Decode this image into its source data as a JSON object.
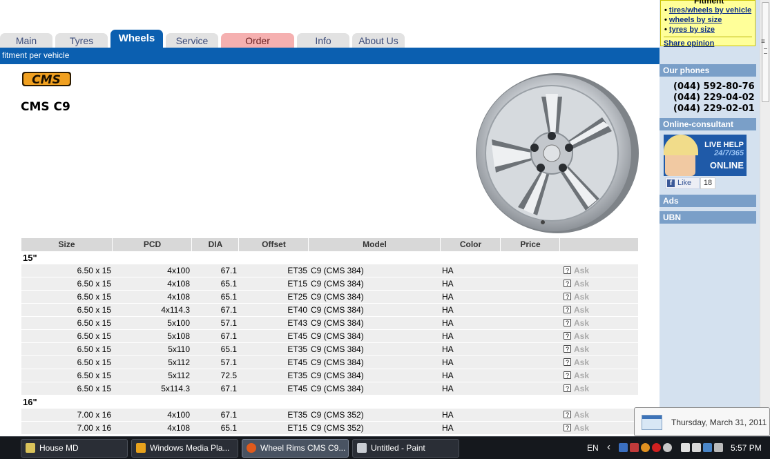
{
  "tabs": [
    "Main",
    "Tyres",
    "Wheels",
    "Service",
    "Order",
    "Info",
    "About Us"
  ],
  "subnav": "fitment per vehicle",
  "brand_logo_text": "CMS",
  "product_title": "CMS C9",
  "table": {
    "headers": [
      "Size",
      "PCD",
      "DIA",
      "Offset",
      "Model",
      "Color",
      "Price",
      ""
    ],
    "groups": [
      {
        "label": "15\"",
        "rows": [
          {
            "size": "6.50 x 15",
            "pcd": "4x100",
            "dia": "67.1",
            "offset": "ET35",
            "model": "C9 (CMS 384)",
            "color": "HA",
            "price": "",
            "ask": "Ask"
          },
          {
            "size": "6.50 x 15",
            "pcd": "4x108",
            "dia": "65.1",
            "offset": "ET15",
            "model": "C9 (CMS 384)",
            "color": "HA",
            "price": "",
            "ask": "Ask"
          },
          {
            "size": "6.50 x 15",
            "pcd": "4x108",
            "dia": "65.1",
            "offset": "ET25",
            "model": "C9 (CMS 384)",
            "color": "HA",
            "price": "",
            "ask": "Ask"
          },
          {
            "size": "6.50 x 15",
            "pcd": "4x114.3",
            "dia": "67.1",
            "offset": "ET40",
            "model": "C9 (CMS 384)",
            "color": "HA",
            "price": "",
            "ask": "Ask"
          },
          {
            "size": "6.50 x 15",
            "pcd": "5x100",
            "dia": "57.1",
            "offset": "ET43",
            "model": "C9 (CMS 384)",
            "color": "HA",
            "price": "",
            "ask": "Ask"
          },
          {
            "size": "6.50 x 15",
            "pcd": "5x108",
            "dia": "67.1",
            "offset": "ET45",
            "model": "C9 (CMS 384)",
            "color": "HA",
            "price": "",
            "ask": "Ask"
          },
          {
            "size": "6.50 x 15",
            "pcd": "5x110",
            "dia": "65.1",
            "offset": "ET35",
            "model": "C9 (CMS 384)",
            "color": "HA",
            "price": "",
            "ask": "Ask"
          },
          {
            "size": "6.50 x 15",
            "pcd": "5x112",
            "dia": "57.1",
            "offset": "ET45",
            "model": "C9 (CMS 384)",
            "color": "HA",
            "price": "",
            "ask": "Ask"
          },
          {
            "size": "6.50 x 15",
            "pcd": "5x112",
            "dia": "72.5",
            "offset": "ET35",
            "model": "C9 (CMS 384)",
            "color": "HA",
            "price": "",
            "ask": "Ask"
          },
          {
            "size": "6.50 x 15",
            "pcd": "5x114.3",
            "dia": "67.1",
            "offset": "ET45",
            "model": "C9 (CMS 384)",
            "color": "HA",
            "price": "",
            "ask": "Ask"
          }
        ]
      },
      {
        "label": "16\"",
        "rows": [
          {
            "size": "7.00 x 16",
            "pcd": "4x100",
            "dia": "67.1",
            "offset": "ET35",
            "model": "C9 (CMS 352)",
            "color": "HA",
            "price": "",
            "ask": "Ask"
          },
          {
            "size": "7.00 x 16",
            "pcd": "4x108",
            "dia": "65.1",
            "offset": "ET15",
            "model": "C9 (CMS 352)",
            "color": "HA",
            "price": "",
            "ask": "Ask"
          }
        ]
      }
    ]
  },
  "sidebar": {
    "fitment_title": "Fitment",
    "fitment_links": [
      "tires/wheels by vehicle",
      "wheels by size",
      "tyres by size"
    ],
    "share_link": "Share opinion",
    "phones_heading": "Our phones",
    "phones": [
      "(044) 592-80-76",
      "(044) 229-04-02",
      "(044) 229-02-01"
    ],
    "consultant_heading": "Online-consultant",
    "live_help": {
      "line1": "LIVE HELP",
      "line2": "24/7/365",
      "line3": "ONLINE"
    },
    "like_label": "Like",
    "like_count": "18",
    "ads_heading": "Ads",
    "ubn_heading": "UBN"
  },
  "date_popup": "Thursday, March 31, 2011",
  "taskbar": {
    "tasks": [
      "House MD",
      "Windows Media Pla...",
      "Wheel Rims CMS C9...",
      "Untitled - Paint"
    ],
    "lang": "EN",
    "time": "5:57 PM"
  },
  "colors": {
    "nav_blue": "#0b5fb0",
    "sidebar_bg": "#d4e1ef",
    "sidebar_heading": "#7a9fc8",
    "fitment_bg": "#ffff99",
    "logo_orange": "#f0a020"
  }
}
